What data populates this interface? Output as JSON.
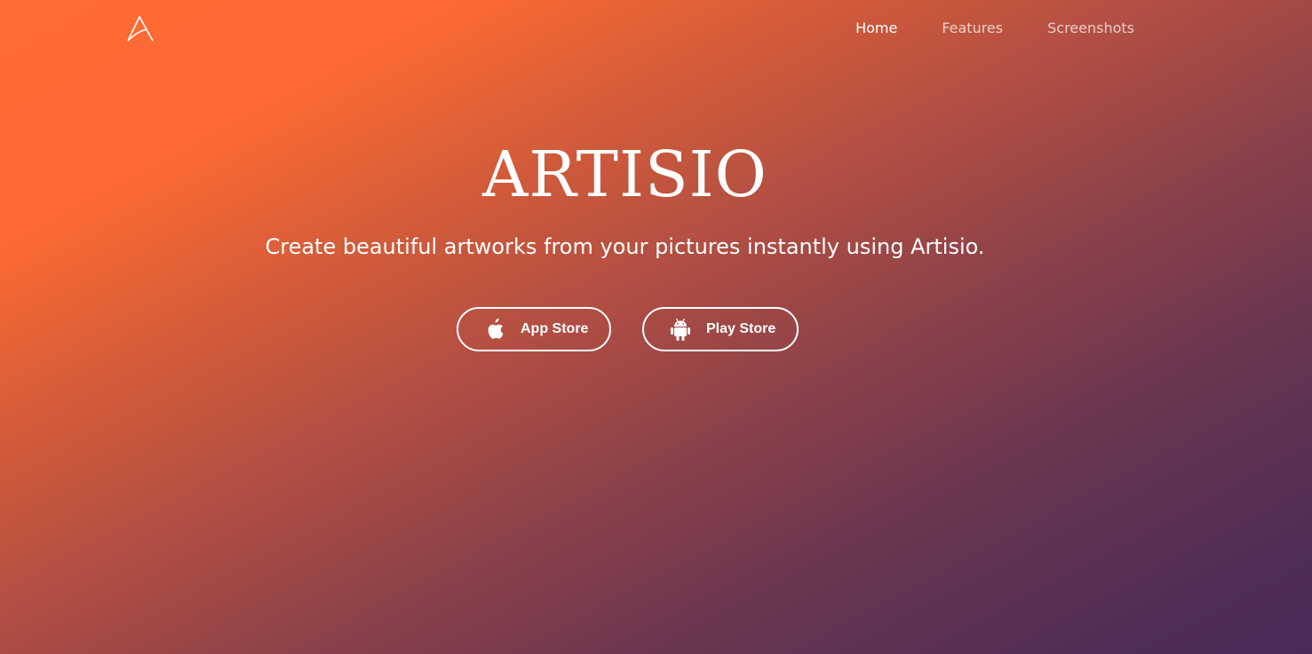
{
  "header": {
    "logo_icon": "artisio-logo-icon",
    "nav": [
      {
        "label": "Home",
        "active": true
      },
      {
        "label": "Features",
        "active": false
      },
      {
        "label": "Screenshots",
        "active": false
      }
    ]
  },
  "hero": {
    "title": "ARTISIO",
    "tagline": "Create beautiful artworks from your pictures instantly using Artisio.",
    "buttons": {
      "app_store": {
        "label": "App Store",
        "icon": "apple-icon"
      },
      "play_store": {
        "label": "Play Store",
        "icon": "android-icon"
      }
    }
  },
  "colors": {
    "gradient_start": "#ff6b33",
    "gradient_end": "#4a2b56",
    "text": "#ffffff"
  }
}
